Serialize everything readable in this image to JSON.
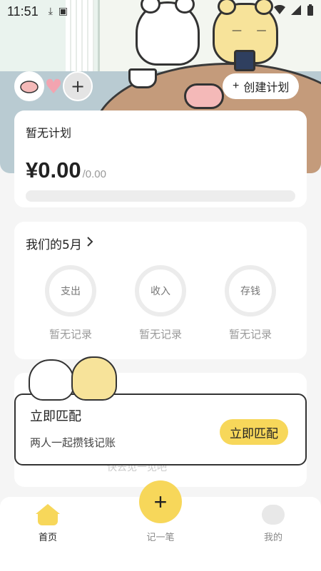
{
  "status_bar": {
    "time": "11:51",
    "left_icons": [
      "download-icon",
      "a-icon"
    ],
    "right_icons": [
      "wifi-icon",
      "signal-icon",
      "battery-icon"
    ]
  },
  "header": {
    "create_plan_label": "创建计划",
    "create_plan_icon": "plus-icon",
    "avatars": [
      "pig-avatar-icon",
      "heart-icon",
      "add-partner-icon"
    ]
  },
  "plan": {
    "title": "暂无计划",
    "amount": "¥0.00",
    "target": "/0.00",
    "progress": 0
  },
  "month": {
    "title": "我们的5月",
    "stats": [
      {
        "label": "支出",
        "note": "暂无记录"
      },
      {
        "label": "收入",
        "note": "暂无记录"
      },
      {
        "label": "存钱",
        "note": "暂无记录"
      }
    ]
  },
  "match": {
    "title": "立即匹配",
    "subtitle": "两人一起攒钱记账",
    "button": "立即匹配",
    "hidden_text": "快去见一见吧"
  },
  "nav": {
    "home": "首页",
    "record": "记一笔",
    "mine": "我的",
    "fab": "+"
  },
  "colors": {
    "accent": "#f7d75a",
    "background": "#f5f5f5",
    "card": "#ffffff",
    "muted": "#999999"
  }
}
